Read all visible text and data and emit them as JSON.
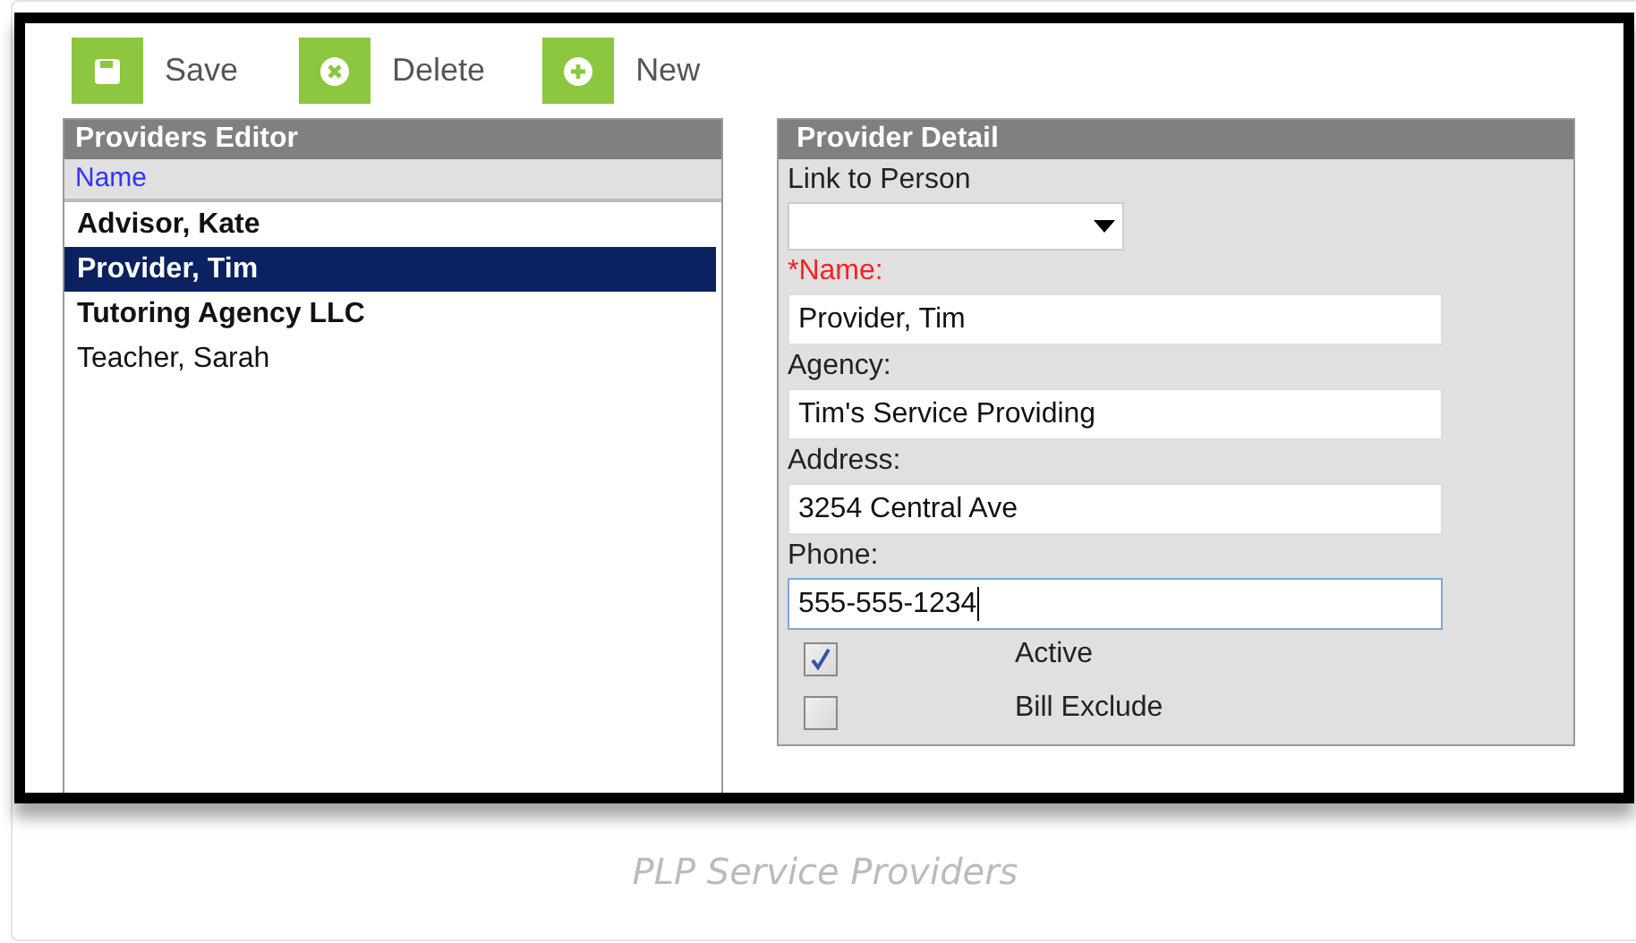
{
  "toolbar": [
    {
      "label": "Save",
      "kind": "save"
    },
    {
      "label": "Delete",
      "kind": "delete"
    },
    {
      "label": "New",
      "kind": "new"
    }
  ],
  "providers_editor": {
    "title": "Providers Editor",
    "column": "Name",
    "rows": [
      {
        "name": "Advisor, Kate",
        "bold": true,
        "selected": false
      },
      {
        "name": "Provider, Tim",
        "bold": true,
        "selected": true
      },
      {
        "name": "Tutoring Agency LLC",
        "bold": true,
        "selected": false
      },
      {
        "name": "Teacher, Sarah",
        "bold": false,
        "selected": false
      }
    ]
  },
  "provider_detail": {
    "title": "Provider Detail",
    "fields": [
      {
        "kind": "select",
        "label": "Link to Person",
        "required": false
      },
      {
        "kind": "text",
        "label": "*Name:",
        "value": "Provider, Tim",
        "required": true
      },
      {
        "kind": "text",
        "label": "Agency:",
        "value": "Tim's Service Providing",
        "required": false
      },
      {
        "kind": "text",
        "label": "Address:",
        "value": "3254 Central Ave",
        "required": false
      },
      {
        "kind": "text",
        "label": "Phone:",
        "value": "555-555-1234",
        "required": false,
        "focused": true
      }
    ],
    "checkboxes": [
      {
        "label": "Active",
        "checked": true
      },
      {
        "label": "Bill Exclude",
        "checked": false
      }
    ]
  },
  "caption": "PLP Service Providers"
}
